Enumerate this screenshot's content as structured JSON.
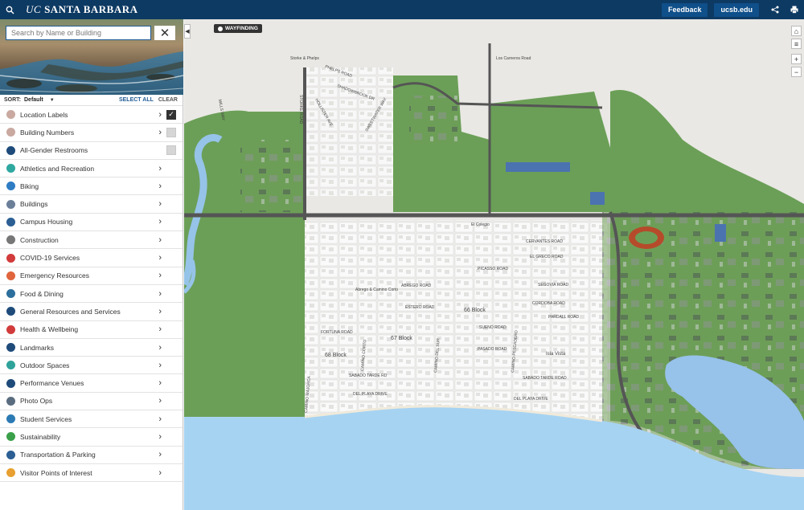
{
  "header": {
    "brand_prefix": "UC",
    "brand_name": "SANTA BARBARA",
    "feedback_label": "Feedback",
    "ucsb_label": "ucsb.edu"
  },
  "sidebar": {
    "search_placeholder": "Search by Name or Building",
    "sort_label": "SORT:",
    "sort_value": "Default",
    "select_all": "SELECT ALL",
    "clear": "CLEAR",
    "layers": [
      {
        "label": "Location Labels",
        "icon": "label-icon",
        "color": "#c9a9a0",
        "checkbox": "checked"
      },
      {
        "label": "Building Numbers",
        "icon": "building-number-icon",
        "color": "#c9a9a0",
        "checkbox": "unchecked"
      },
      {
        "label": "All-Gender Restrooms",
        "icon": "restroom-icon",
        "color": "#1e4b7a",
        "checkbox": "unchecked-nochevron"
      },
      {
        "label": "Athletics and Recreation",
        "icon": "athletics-icon",
        "color": "#2fa8a0"
      },
      {
        "label": "Biking",
        "icon": "bike-icon",
        "color": "#2e7dc4"
      },
      {
        "label": "Buildings",
        "icon": "building-icon",
        "color": "#6b7f99"
      },
      {
        "label": "Campus Housing",
        "icon": "housing-icon",
        "color": "#2c5f94"
      },
      {
        "label": "Construction",
        "icon": "construction-icon",
        "color": "#777777"
      },
      {
        "label": "COVID-19 Services",
        "icon": "covid-icon",
        "color": "#d23b3b"
      },
      {
        "label": "Emergency Resources",
        "icon": "emergency-icon",
        "color": "#e0643c"
      },
      {
        "label": "Food & Dining",
        "icon": "food-icon",
        "color": "#2c6e9c"
      },
      {
        "label": "General Resources and Services",
        "icon": "resources-icon",
        "color": "#1e4b7a"
      },
      {
        "label": "Health & Wellbeing",
        "icon": "health-icon",
        "color": "#d23b3b"
      },
      {
        "label": "Landmarks",
        "icon": "landmark-icon",
        "color": "#1e4b7a"
      },
      {
        "label": "Outdoor Spaces",
        "icon": "outdoor-icon",
        "color": "#2fa39a"
      },
      {
        "label": "Performance Venues",
        "icon": "performance-icon",
        "color": "#1e4b7a"
      },
      {
        "label": "Photo Ops",
        "icon": "camera-icon",
        "color": "#5a6c80"
      },
      {
        "label": "Student Services",
        "icon": "student-icon",
        "color": "#2c7ab4"
      },
      {
        "label": "Sustainability",
        "icon": "leaf-icon",
        "color": "#3aa04a"
      },
      {
        "label": "Transportation & Parking",
        "icon": "parking-icon",
        "color": "#2c5f94"
      },
      {
        "label": "Visitor Points of Interest",
        "icon": "star-icon",
        "color": "#e8a030"
      }
    ]
  },
  "map": {
    "wayfinding_label": "WAYFINDING",
    "controls": [
      "home-icon",
      "layers-icon",
      "zoom-in-icon",
      "zoom-out-icon"
    ],
    "street_labels": [
      "Storke & Phelps",
      "PHELPS ROAD",
      "SHADOWBROOK DR",
      "MILLS WAY",
      "STORKE ROAD",
      "HOLLISTER AVE",
      "SWEETWATER WAY",
      "Los Carneros Road",
      "El Colegio",
      "CERVANTES ROAD",
      "EL GRECO ROAD",
      "PICASSO ROAD",
      "SEGOVIA ROAD",
      "ABREGO ROAD",
      "ESTERO ROAD",
      "Abrego & Camino Corto",
      "66 Block",
      "CORDOBA ROAD",
      "PARDALL ROAD",
      "SUENO ROAD",
      "FORTUNA ROAD",
      "67 Block",
      "PASADO ROAD",
      "68 Block",
      "SABADO TARDE RD",
      "SABADO TARDE ROAD",
      "DEL PLAYA DRIVE",
      "DEL PLAYA DRIVE",
      "Isla Vista",
      "CAMINO CORTO",
      "CAMINO DEL SUR",
      "CAMINO PESCADERO",
      "CAMINO MAJORCA"
    ]
  },
  "colors": {
    "header_bg": "#0d3a63",
    "accent_button": "#0f4f8a",
    "campus_green": "#6b9f57",
    "ocean": "#a7d3f2",
    "lagoon": "#97c2ea",
    "street_bg": "#e9e8e4"
  }
}
